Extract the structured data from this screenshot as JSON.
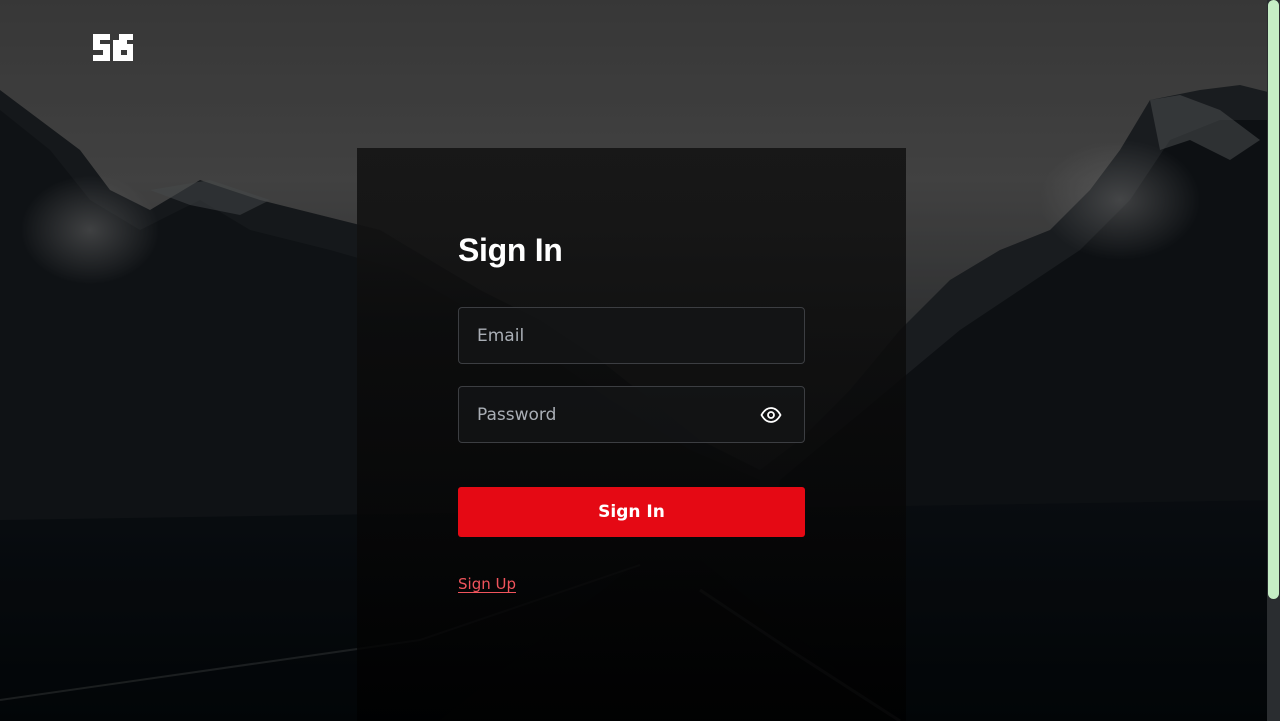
{
  "logo": {
    "name": "brand-logo",
    "colour": "#ffffff"
  },
  "form": {
    "title": "Sign In",
    "email_placeholder": "Email",
    "password_placeholder": "Password",
    "show_password_icon": "eye-icon",
    "submit_label": "Sign In",
    "signup_link": "Sign Up"
  },
  "colors": {
    "accent": "#e50914",
    "link": "#f0545c",
    "scrollbar_thumb": "#c6eec6"
  }
}
